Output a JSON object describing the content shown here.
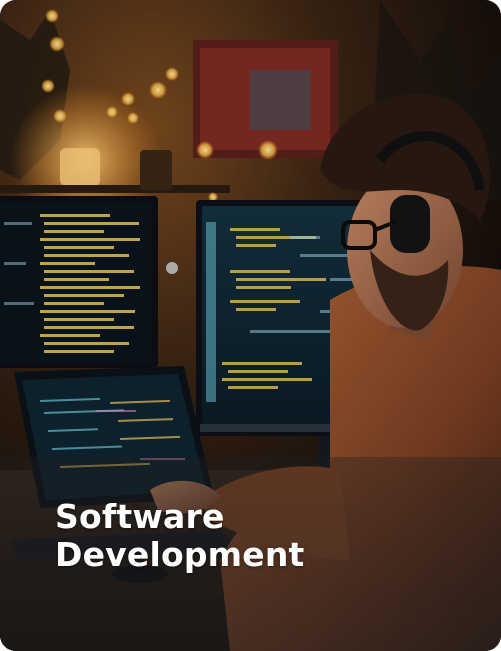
{
  "card": {
    "title_line_1": "Software",
    "title_line_2": "Development"
  },
  "image": {
    "subject": "developer-at-computer"
  },
  "colors": {
    "caption_text": "#ffffff",
    "code_yellow": "#e8c25a",
    "code_cyan": "#6ec8d8",
    "screen_bg": "#0e1e2a",
    "warm_light": "#ffb347"
  }
}
